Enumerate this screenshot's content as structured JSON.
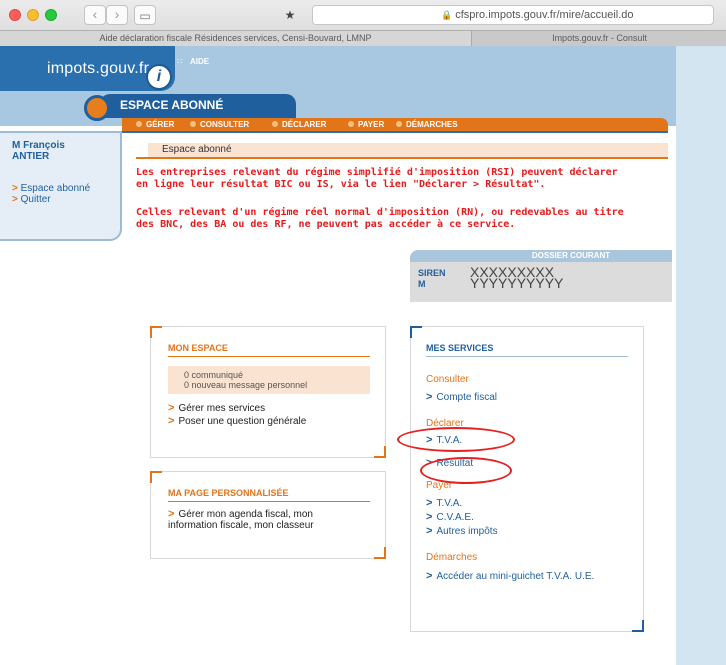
{
  "browser": {
    "back_label": "‹",
    "forward_label": "›",
    "sidebar_icon": "▭",
    "star_icon": "★",
    "url": "cfspro.impots.gouv.fr/mire/accueil.do",
    "tab_active": "Aide déclaration fiscale Résidences services, Censi-Bouvard, LMNP",
    "tab_other": "Impots.gouv.fr - Consult"
  },
  "header": {
    "logo_text": "impots.gouv.fr",
    "logo_mark": "i",
    "aide_label": "AIDE",
    "espace_title": "ESPACE ABONNÉ"
  },
  "menu": [
    "GÉRER",
    "CONSULTER",
    "DÉCLARER",
    "PAYER",
    "DÉMARCHES"
  ],
  "sidebar": {
    "user_line1": "M François",
    "user_line2": "ANTIER",
    "links": [
      "Espace abonné",
      "Quitter"
    ]
  },
  "main": {
    "breadcrumb": "Espace abonné",
    "notice1_line1": "Les entreprises relevant du régime simplifié d'imposition (RSI) peuvent déclarer",
    "notice1_line2": "en ligne leur résultat BIC ou IS, via le lien \"Déclarer > Résultat\".",
    "notice2_line1": "Celles relevant d'un régime réel normal d'imposition (RN), ou redevables au titre",
    "notice2_line2": "des BNC, des BA ou des RF, ne peuvent pas accéder à ce service."
  },
  "dossier": {
    "title": "DOSSIER COURANT",
    "siren_label": "SIREN",
    "siren_value": "XXXXXXXXX",
    "m_label": "M",
    "m_value": "YYYYYYYYYY"
  },
  "mon_espace": {
    "title": "MON ESPACE",
    "info_line1": "0 communiqué",
    "info_line2": "0 nouveau message personnel",
    "links": [
      "Gérer mes services",
      "Poser une question générale"
    ]
  },
  "ma_page": {
    "title": "MA PAGE PERSONNALISÉE",
    "link_line1": "Gérer mon agenda fiscal, mon",
    "link_line2": "information fiscale, mon classeur"
  },
  "mes_services": {
    "title": "MES SERVICES",
    "consulter_label": "Consulter",
    "consulter_links": [
      "Compte fiscal"
    ],
    "declarer_label": "Déclarer",
    "declarer_links": [
      "T.V.A.",
      "Résultat"
    ],
    "payer_label": "Payer",
    "payer_links": [
      "T.V.A.",
      "C.V.A.E.",
      "Autres impôts"
    ],
    "demarches_label": "Démarches",
    "demarches_links": [
      "Accéder au mini-guichet T.V.A. U.E."
    ]
  },
  "colors": {
    "orange": "#e2741a",
    "blue": "#1f5f9e",
    "red_notice": "#e41c1c",
    "annotation_red": "#e52020"
  }
}
